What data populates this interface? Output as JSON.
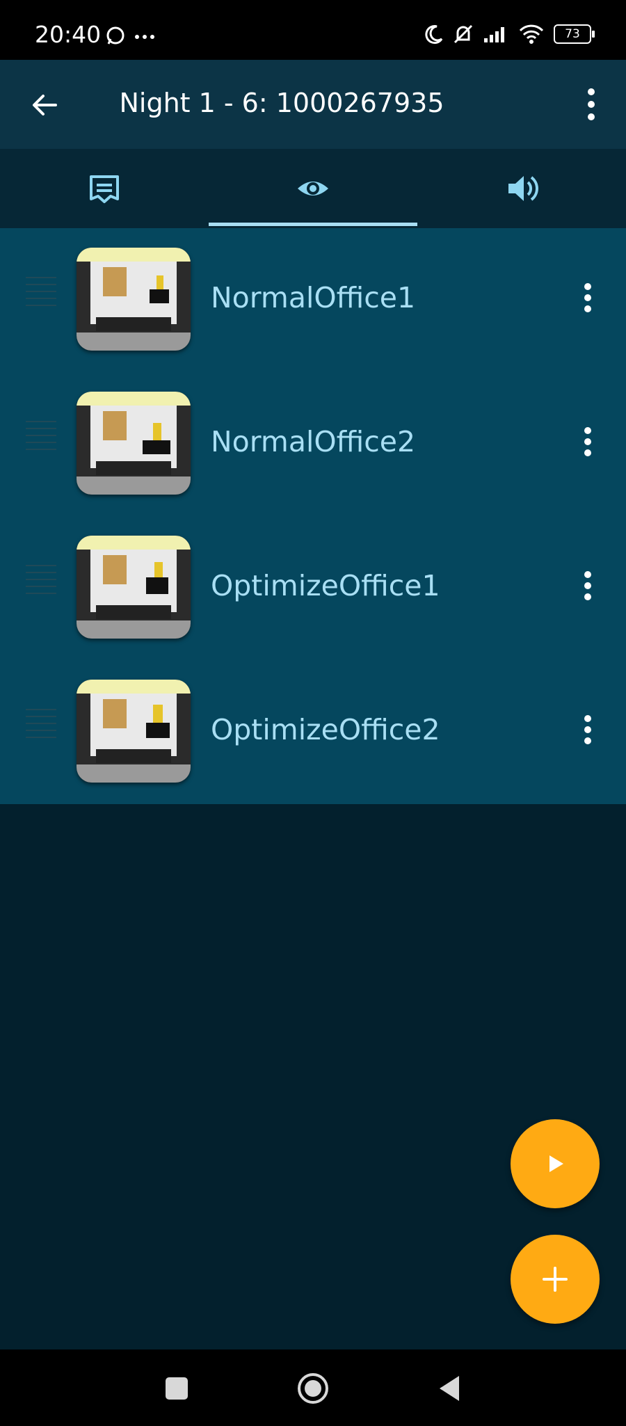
{
  "status_bar": {
    "time": "20:40",
    "battery": "73",
    "icons": [
      "whatsapp-icon",
      "more-dots-icon",
      "moon-icon",
      "notifications-off-icon",
      "signal-icon",
      "wifi-icon",
      "battery-icon"
    ]
  },
  "app_bar": {
    "title": "Night 1 - 6: 1000267935",
    "icons": [
      "back-arrow-icon",
      "overflow-menu-icon"
    ]
  },
  "tabs": [
    {
      "icon": "map-icon",
      "selected": false
    },
    {
      "icon": "eye-icon",
      "selected": true
    },
    {
      "icon": "volume-icon",
      "selected": false
    }
  ],
  "items": [
    {
      "label": "NormalOffice1"
    },
    {
      "label": "NormalOffice2"
    },
    {
      "label": "OptimizeOffice1"
    },
    {
      "label": "OptimizeOffice2"
    }
  ],
  "fabs": [
    "play-icon",
    "add-icon"
  ],
  "nav": [
    "recents-square-icon",
    "home-circle-icon",
    "back-triangle-icon"
  ],
  "colors": {
    "accent": "#ffaa13",
    "tab_indicator": "#a9dff4",
    "list_bg": "#05475e",
    "app_bar_bg": "#0c3446",
    "page_bg": "#03202d"
  }
}
